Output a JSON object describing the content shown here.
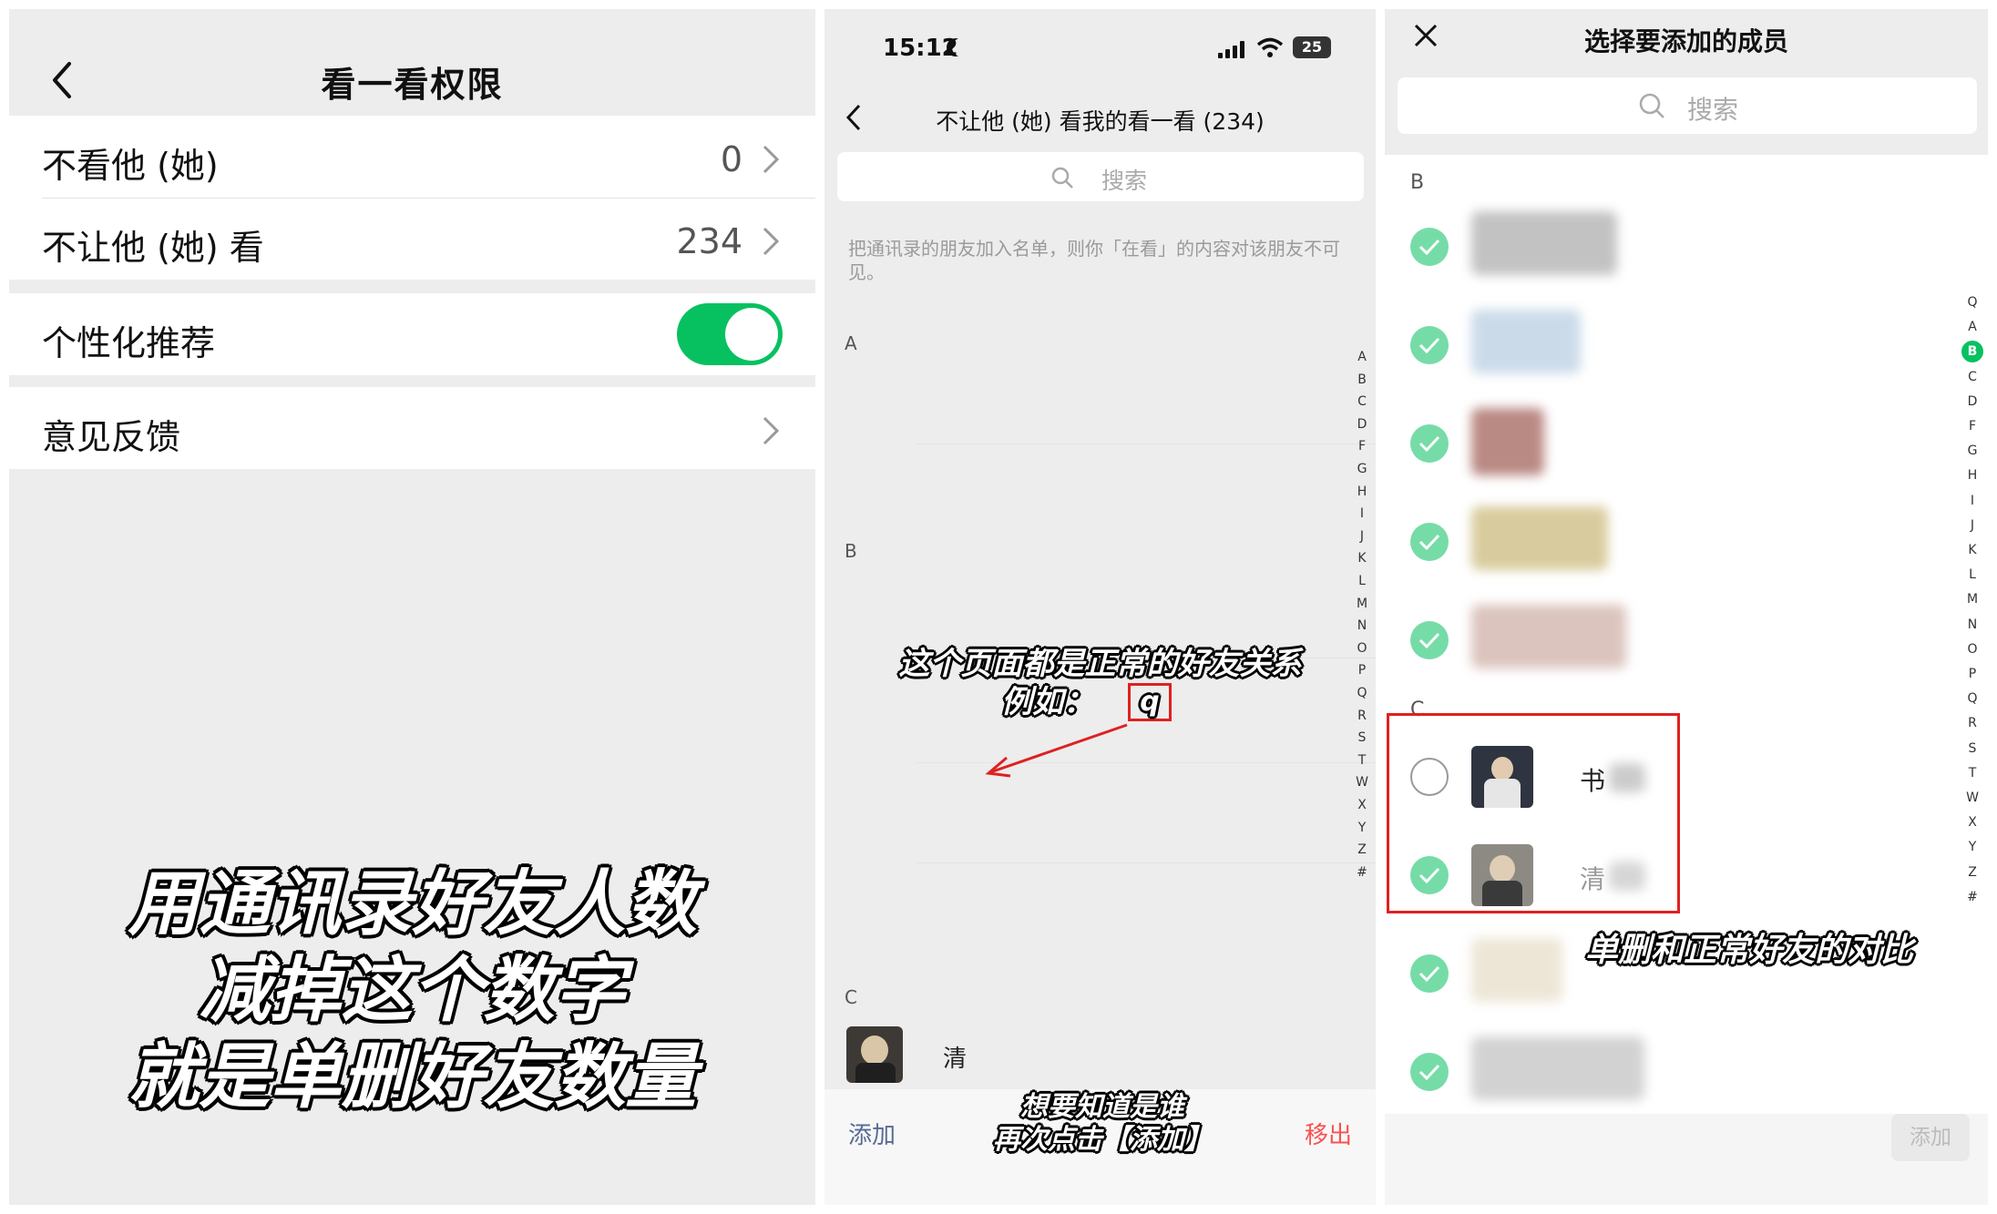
{
  "panel1": {
    "title": "看一看权限",
    "rows": [
      {
        "label": "不看他 (她)",
        "value": "0"
      },
      {
        "label": "不让他 (她) 看",
        "value": "234"
      }
    ],
    "personalized_label": "个性化推荐",
    "personalized_on": true,
    "feedback_label": "意见反馈",
    "caption": [
      "用通讯录好友人数",
      "减掉这个数字",
      "就是单删好友数量"
    ]
  },
  "panel2": {
    "status": {
      "time": "15:12",
      "battery": "25"
    },
    "title": "不让他 (她) 看我的看一看 (234)",
    "search_placeholder": "搜索",
    "hint": "把通讯录的朋友加入名单，则你「在看」的内容对该朋友不可见。",
    "sections": [
      "A",
      "B",
      "C"
    ],
    "index_letters": [
      "A",
      "B",
      "C",
      "D",
      "F",
      "G",
      "H",
      "I",
      "J",
      "K",
      "L",
      "M",
      "N",
      "O",
      "P",
      "Q",
      "R",
      "S",
      "T",
      "W",
      "X",
      "Y",
      "Z",
      "#"
    ],
    "contact_name": "清",
    "add_label": "添加",
    "remove_label": "移出",
    "annotation_top": [
      "这个页面都是正常的好友关系",
      "例如："
    ],
    "annotation_box_text": "q",
    "annotation_bottom": [
      "想要知道是谁",
      "再次点击【添加】"
    ]
  },
  "panel3": {
    "title": "选择要添加的成员",
    "search_placeholder": "搜索",
    "sections": [
      "B",
      "C"
    ],
    "index_letters": [
      "Q",
      "A",
      "B",
      "C",
      "D",
      "F",
      "G",
      "H",
      "I",
      "J",
      "K",
      "L",
      "M",
      "N",
      "O",
      "P",
      "Q",
      "R",
      "S",
      "T",
      "W",
      "X",
      "Y",
      "Z",
      "#"
    ],
    "active_index": "B",
    "highlight_names": [
      "书",
      "清"
    ],
    "annotation": "单删和正常好友的对比",
    "add_button": "添加"
  },
  "colors": {
    "accent": "#07c160",
    "link": "#576b95",
    "danger": "#fa5151",
    "annotation_box": "#e02020"
  }
}
